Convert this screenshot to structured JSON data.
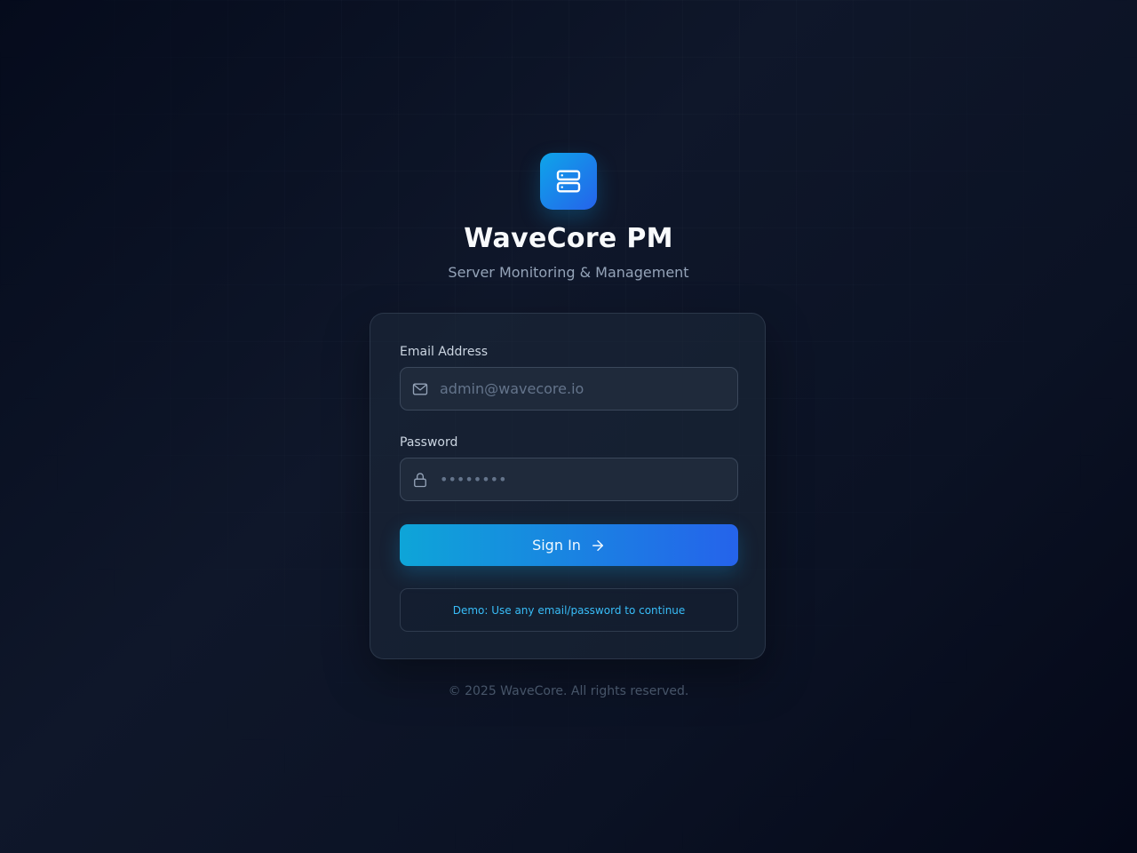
{
  "brand": {
    "logo_icon": "server-icon",
    "title": "WaveCore PM",
    "subtitle": "Server Monitoring & Management"
  },
  "form": {
    "email": {
      "label": "Email Address",
      "icon": "mail-icon",
      "placeholder": "admin@wavecore.io",
      "value": ""
    },
    "password": {
      "label": "Password",
      "icon": "lock-icon",
      "placeholder": "••••••••",
      "value": ""
    },
    "submit": {
      "label": "Sign In",
      "icon": "arrow-right-icon"
    },
    "demo_note": "Demo: Use any email/password to continue"
  },
  "footer": {
    "copyright": "© 2025 WaveCore. All rights reserved."
  },
  "colors": {
    "accent_start": "#0ea5e9",
    "accent_end": "#2563eb",
    "demo_text": "#38bdf8",
    "background": "#0f172a"
  }
}
